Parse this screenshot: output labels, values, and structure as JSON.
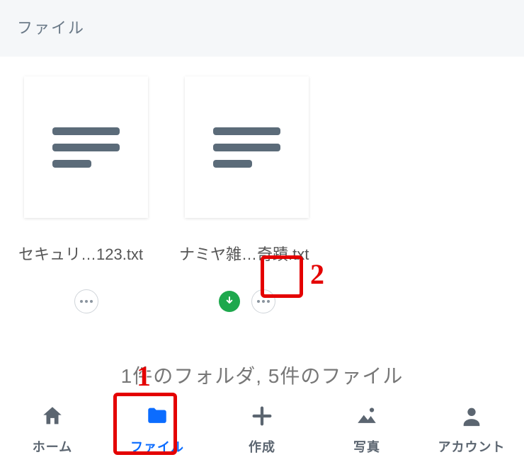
{
  "header": {
    "title": "ファイル"
  },
  "files": [
    {
      "name": "セキュリ…123.txt",
      "has_download": false
    },
    {
      "name": "ナミヤ雑…奇蹟.txt",
      "has_download": true
    }
  ],
  "summary": "1件のフォルダ, 5件のファイル",
  "tabs": {
    "home": {
      "label": "ホーム"
    },
    "files": {
      "label": "ファイル",
      "active": true
    },
    "create": {
      "label": "作成"
    },
    "photos": {
      "label": "写真"
    },
    "account": {
      "label": "アカウント"
    }
  },
  "annotations": {
    "1": {
      "target": "tab-files"
    },
    "2": {
      "target": "file-1-more"
    }
  }
}
